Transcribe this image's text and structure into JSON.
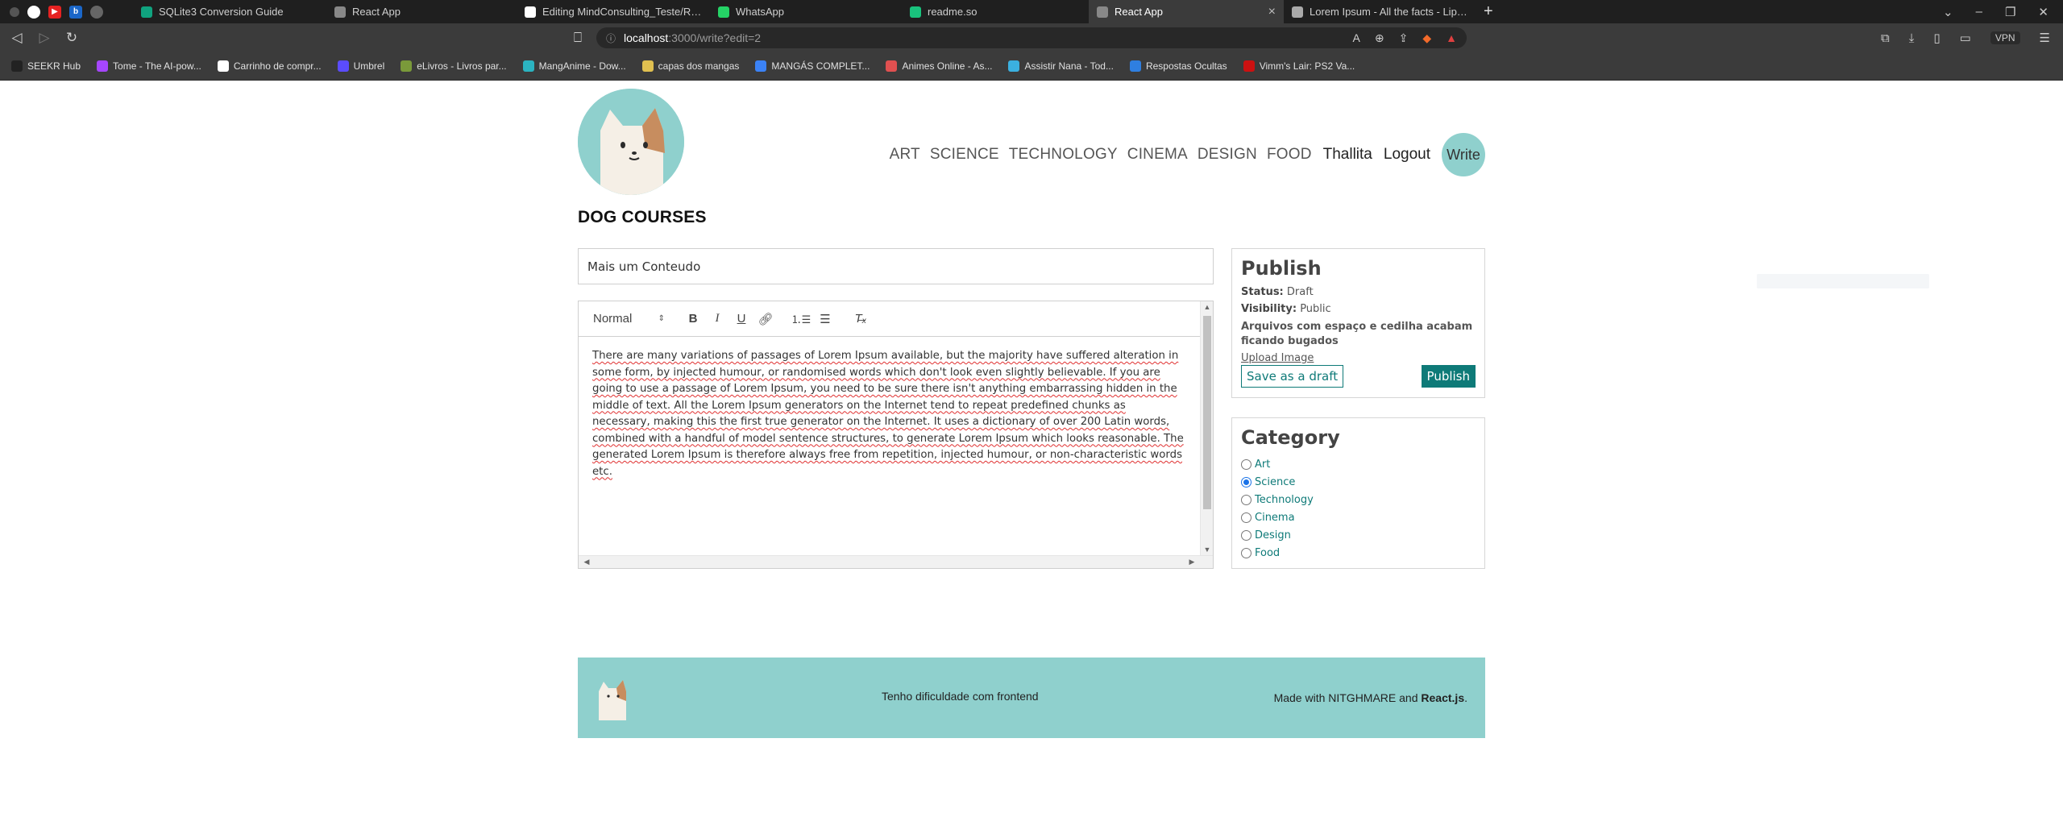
{
  "browser": {
    "tabs": [
      {
        "label": "SQLite3 Conversion Guide",
        "color": "#10a37f",
        "active": false
      },
      {
        "label": "React App",
        "color": "#888888",
        "active": false
      },
      {
        "label": "Editing MindConsulting_Teste/READM",
        "color": "#ffffff",
        "active": false
      },
      {
        "label": "WhatsApp",
        "color": "#25d366",
        "active": false
      },
      {
        "label": "readme.so",
        "color": "#19c37d",
        "active": false
      },
      {
        "label": "React App",
        "color": "#888888",
        "active": true
      },
      {
        "label": "Lorem Ipsum - All the facts - Lipsum g",
        "color": "#aaaaaa",
        "active": false
      }
    ],
    "new_tab_label": "+",
    "url_host": "localhost",
    "url_path": ":3000/write?edit=2",
    "vpn_label": "VPN",
    "bookmarks": [
      {
        "label": "SEEKR Hub",
        "color": "#222222"
      },
      {
        "label": "Tome - The AI-pow...",
        "color": "#a646ff"
      },
      {
        "label": "Carrinho de compr...",
        "color": "#ffffff"
      },
      {
        "label": "Umbrel",
        "color": "#5b4cff"
      },
      {
        "label": "eLivros - Livros par...",
        "color": "#7a9a3a"
      },
      {
        "label": "MangAnime - Dow...",
        "color": "#2bb3c0"
      },
      {
        "label": "capas dos mangas",
        "color": "#e0c050"
      },
      {
        "label": "MANGÁS COMPLET...",
        "color": "#3b82f6"
      },
      {
        "label": "Animes Online - As...",
        "color": "#e05050"
      },
      {
        "label": "Assistir Nana - Tod...",
        "color": "#3bb0e0"
      },
      {
        "label": "Respostas Ocultas",
        "color": "#2f7fe0"
      },
      {
        "label": "Vimm's Lair: PS2 Va...",
        "color": "#cc1111"
      }
    ]
  },
  "site": {
    "brand": "DOG COURSES",
    "nav": [
      "ART",
      "SCIENCE",
      "TECHNOLOGY",
      "CINEMA",
      "DESIGN",
      "FOOD"
    ],
    "user": "Thallita",
    "logout": "Logout",
    "write": "Write"
  },
  "write": {
    "title_value": "Mais um Conteudo",
    "editor": {
      "format_select": "Normal",
      "toolbar_icons": [
        "bold-icon",
        "italic-icon",
        "underline-icon",
        "link-icon",
        "ordered-list-icon",
        "bullet-list-icon",
        "clear-format-icon"
      ],
      "body": "There are many variations of passages of Lorem Ipsum available, but the majority have suffered alteration in some form, by injected humour, or randomised words which don't look even slightly believable. If you are going to use a passage of Lorem Ipsum, you need to be sure there isn't anything embarrassing hidden in the middle of text. All the Lorem Ipsum generators on the Internet tend to repeat predefined chunks as necessary, making this the first true generator on the Internet. It uses a dictionary of over 200 Latin words, combined with a handful of model sentence structures, to generate Lorem Ipsum which looks reasonable. The generated Lorem Ipsum is therefore always free from repetition, injected humour, or non-characteristic words etc."
    },
    "publish": {
      "title": "Publish",
      "status_label": "Status:",
      "status_value": "Draft",
      "visibility_label": "Visibility:",
      "visibility_value": "Public",
      "note": "Arquivos com espaço e cedilha acabam ficando bugados",
      "upload": "Upload Image",
      "draft_button": "Save as a draft",
      "publish_button": "Publish"
    },
    "category": {
      "title": "Category",
      "options": [
        {
          "label": "Art",
          "checked": false
        },
        {
          "label": "Science",
          "checked": true
        },
        {
          "label": "Technology",
          "checked": false
        },
        {
          "label": "Cinema",
          "checked": false
        },
        {
          "label": "Design",
          "checked": false
        },
        {
          "label": "Food",
          "checked": false
        }
      ]
    }
  },
  "footer": {
    "text": "Tenho dificuldade com frontend",
    "made_prefix": "Made with NITGHMARE and ",
    "made_bold": "React.js",
    "made_suffix": "."
  },
  "colors": {
    "accent": "#8fd0cd",
    "primary_button": "#0e7a78",
    "browser_bg": "#1f1f1f",
    "toolbar_bg": "#3b3b3b"
  }
}
